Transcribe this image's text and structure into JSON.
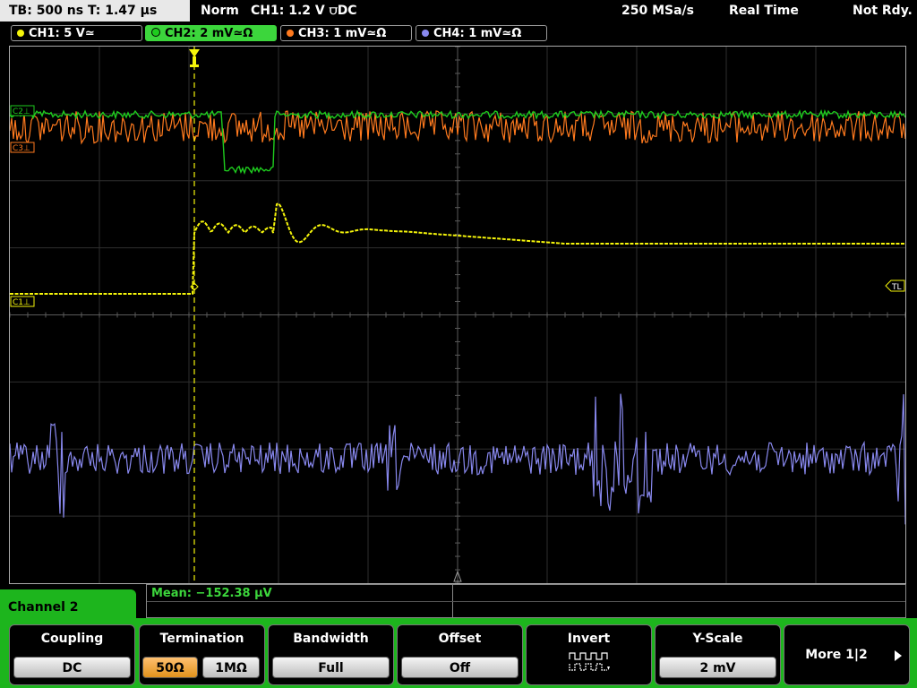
{
  "status": {
    "timebase": "TB: 500 ns   T: 1.47 µs",
    "mode": "Norm",
    "trigger": "CH1: 1.2 V ⩌DC",
    "sample_rate": "250 MSa/s",
    "acq": "Real Time",
    "ready": "Not Rdy."
  },
  "channels": [
    {
      "label": "CH1: 5 V≃",
      "color": "#f5f50a"
    },
    {
      "label": "CH2: 2 mV≃Ω",
      "color": "#1ecc1e"
    },
    {
      "label": "CH3: 1 mV≃Ω",
      "color": "#ff7a1e"
    },
    {
      "label": "CH4: 1 mV≃Ω",
      "color": "#8888ee"
    }
  ],
  "markers": {
    "c3": "C3⊥",
    "c1": "C1⊥",
    "c2": "C2⊥",
    "tl": "TL"
  },
  "measurement": "Mean: −152.38 µV",
  "channel_panel": "Channel 2",
  "softkeys": {
    "coupling": {
      "title": "Coupling",
      "value": "DC"
    },
    "termination": {
      "title": "Termination",
      "opt1": "50Ω",
      "opt2": "1MΩ"
    },
    "bandwidth": {
      "title": "Bandwidth",
      "value": "Full"
    },
    "offset": {
      "title": "Offset",
      "value": "Off"
    },
    "invert": {
      "title": "Invert"
    },
    "yscale": {
      "title": "Y-Scale",
      "value": "2 mV"
    },
    "more": {
      "label": "More 1|2"
    }
  }
}
